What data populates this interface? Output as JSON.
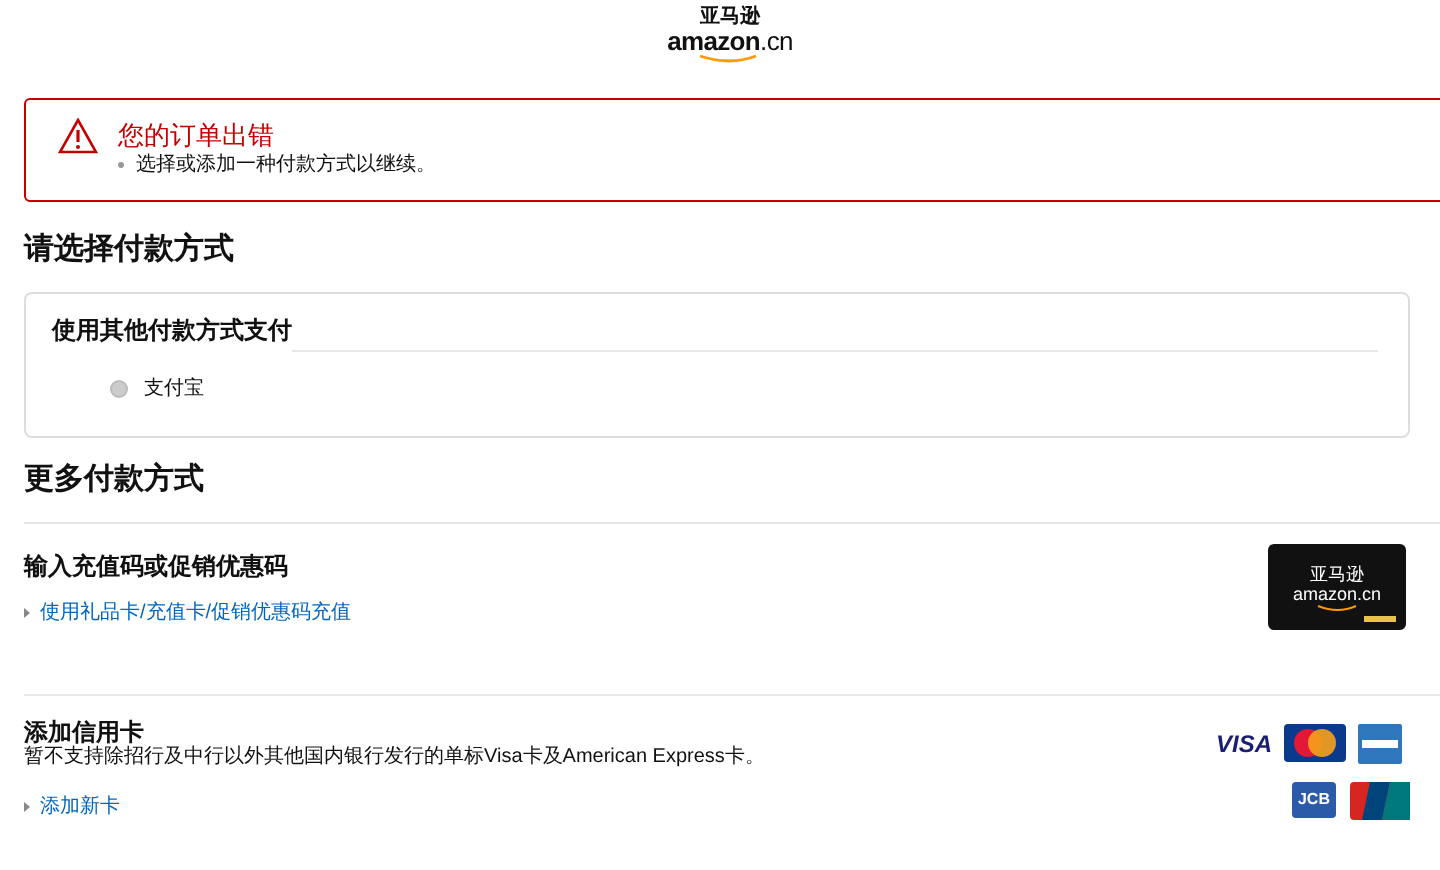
{
  "header": {
    "logo_cn": "亚马逊",
    "logo_en": "amazon",
    "logo_suffix": ".cn"
  },
  "alert": {
    "title": "您的订单出错",
    "items": [
      "选择或添加一种付款方式以继续。"
    ]
  },
  "select_heading": "请选择付款方式",
  "other_methods": {
    "title": "使用其他付款方式支付",
    "options": [
      {
        "label": "支付宝",
        "selected": false
      }
    ]
  },
  "more_heading": "更多付款方式",
  "gift": {
    "title": "输入充值码或促销优惠码",
    "link": "使用礼品卡/充值卡/促销优惠码充值",
    "card_cn": "亚马逊",
    "card_en": "amazon",
    "card_suffix": ".cn"
  },
  "credit": {
    "title": "添加信用卡",
    "note": "暂不支持除招行及中行以外其他国内银行发行的单标Visa卡及American Express卡。",
    "link": "添加新卡",
    "brands": [
      {
        "kind": "visa",
        "label": "VISA"
      },
      {
        "kind": "mastercard"
      },
      {
        "kind": "amex"
      },
      {
        "kind": "jcb",
        "label": "JCB"
      },
      {
        "kind": "unionpay"
      }
    ]
  }
}
